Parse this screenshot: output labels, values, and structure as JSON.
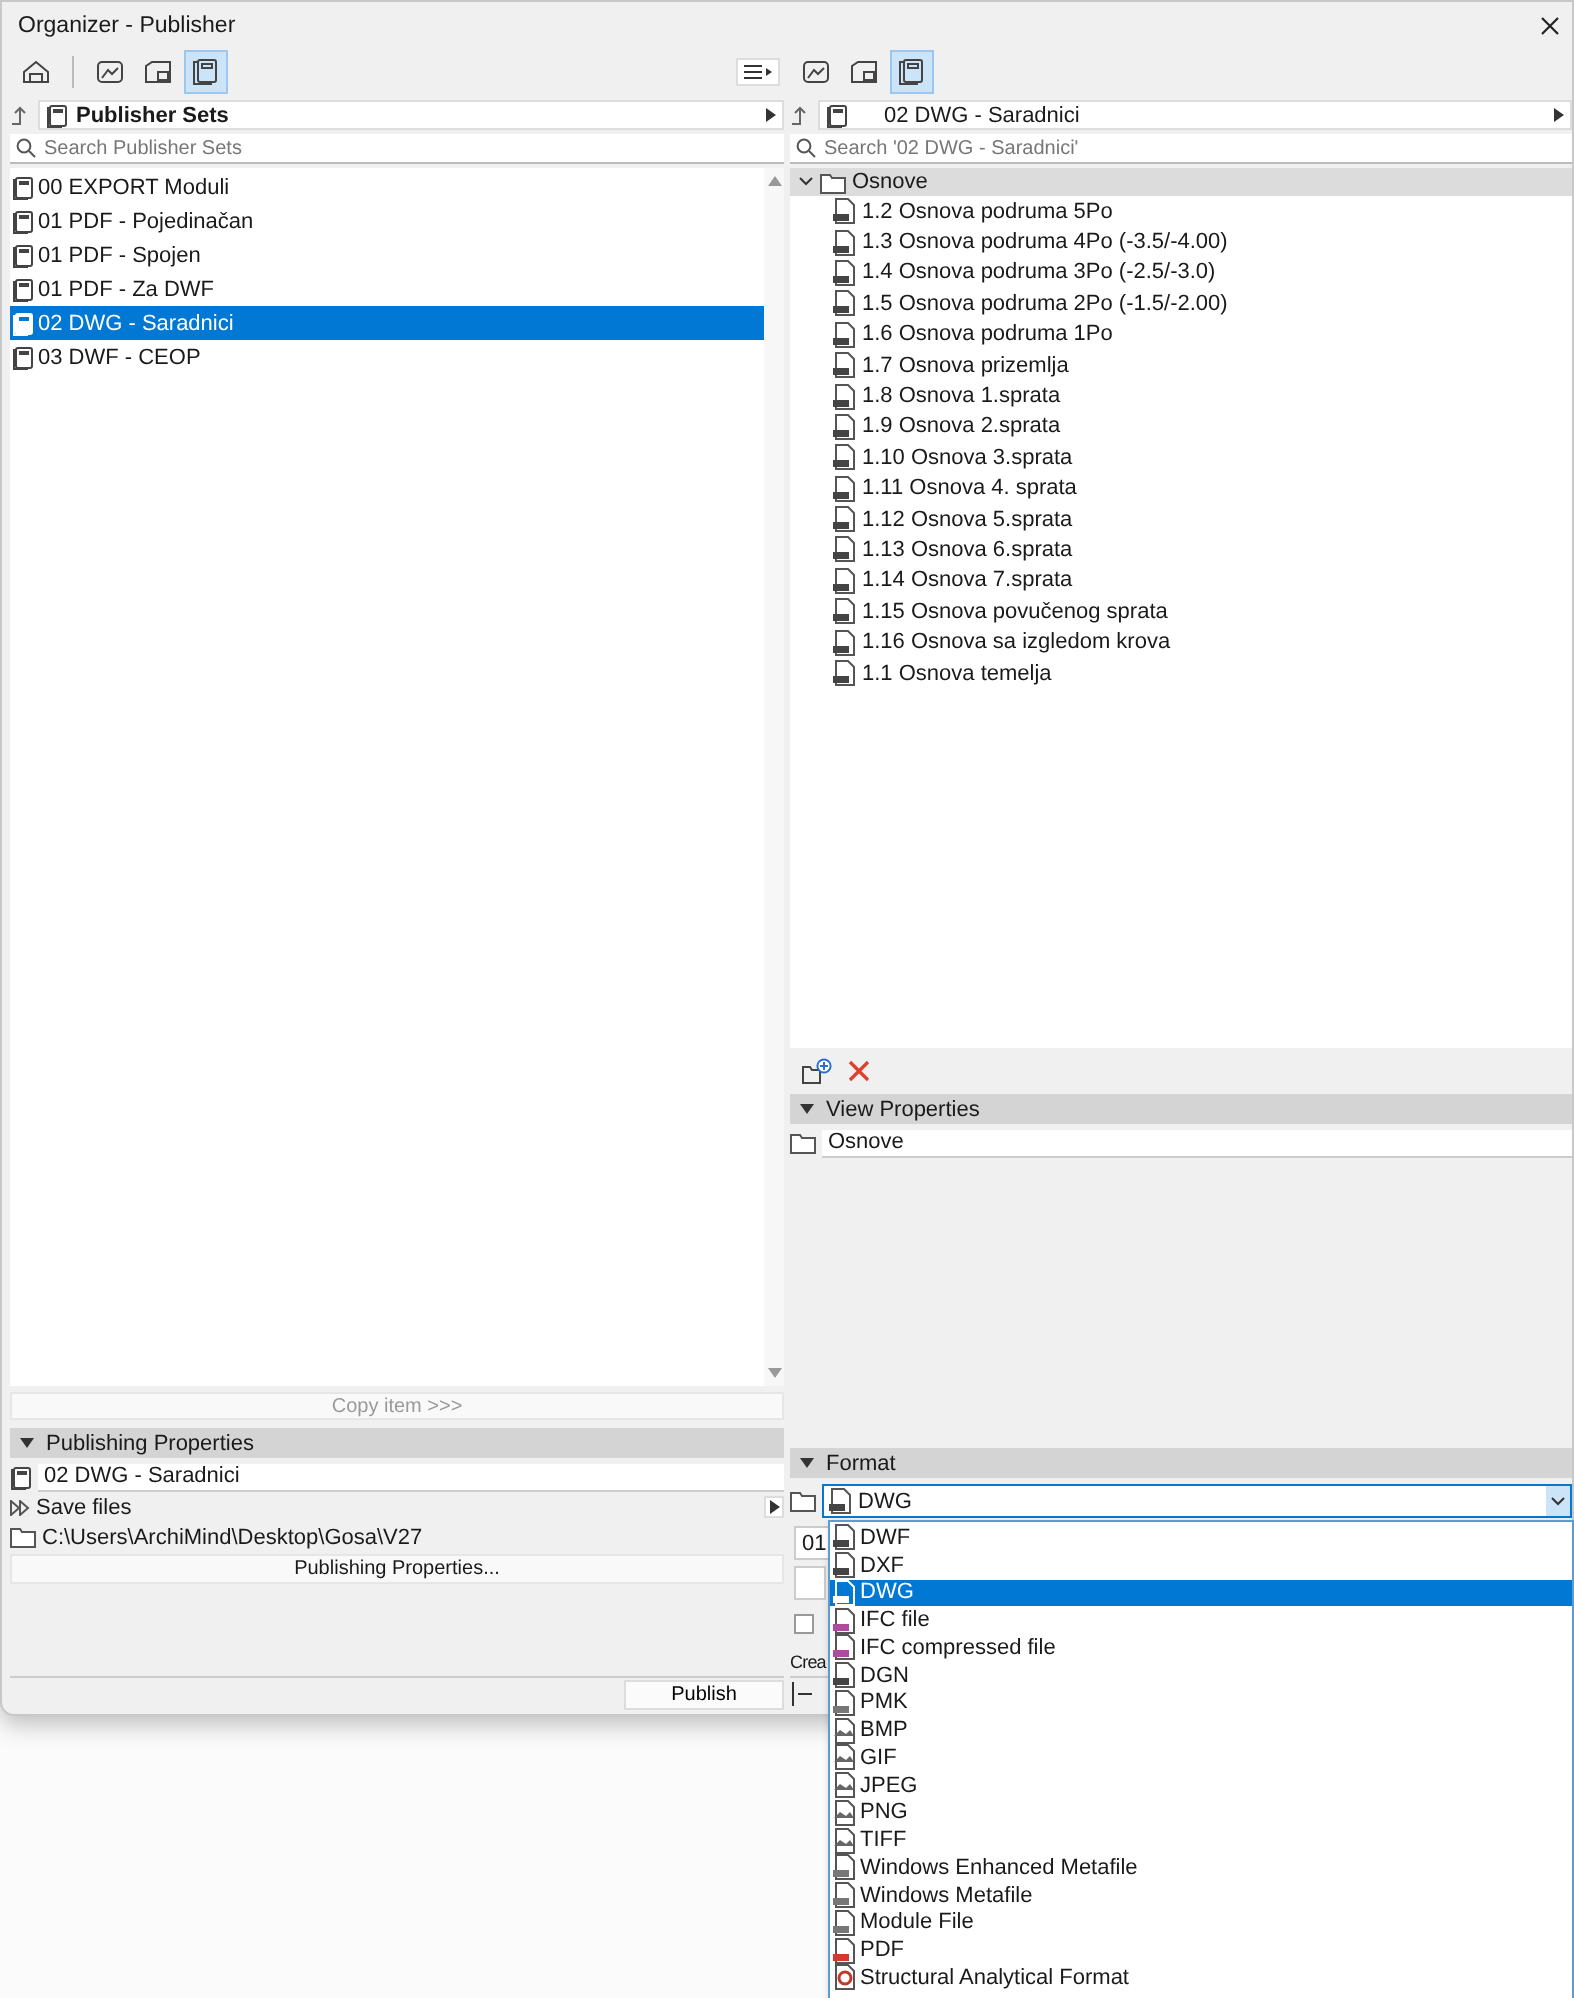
{
  "window": {
    "title": "Organizer - Publisher"
  },
  "left_panel": {
    "toolbar": [
      {
        "kind": "project",
        "selected": false
      },
      {
        "kind": "views",
        "selected": false
      },
      {
        "kind": "layouts",
        "selected": false
      },
      {
        "kind": "sets",
        "selected": true
      }
    ],
    "path": "Publisher Sets",
    "search": {
      "placeholder": "Search Publisher Sets"
    },
    "sets": [
      {
        "label": "00 EXPORT Moduli",
        "selected": false
      },
      {
        "label": "01 PDF - Pojedinačan",
        "selected": false
      },
      {
        "label": "01 PDF - Spojen",
        "selected": false
      },
      {
        "label": "01 PDF - Za DWF",
        "selected": false
      },
      {
        "label": "02 DWG - Saradnici",
        "selected": true
      },
      {
        "label": "03 DWF - CEOP",
        "selected": false
      }
    ],
    "copy_button": {
      "label": "Copy item >>>",
      "disabled": true
    },
    "publishing_properties": {
      "header": "Publishing Properties",
      "expanded": true,
      "name": "02 DWG - Saradnici",
      "mode": "Save files",
      "path": "C:\\Users\\ArchiMind\\Desktop\\Gosa\\V27",
      "button": "Publishing Properties..."
    },
    "publish_button": "Publish"
  },
  "right_panel": {
    "toolbar": [
      {
        "kind": "views",
        "selected": false
      },
      {
        "kind": "layouts",
        "selected": false
      },
      {
        "kind": "sets",
        "selected": true
      }
    ],
    "path": "02 DWG - Saradnici",
    "search": {
      "placeholder": "Search '02 DWG - Saradnici'"
    },
    "tree": {
      "label": "Osnove",
      "expanded": true,
      "children": [
        {
          "label": "1.2 Osnova podruma 5Po"
        },
        {
          "label": "1.3 Osnova podruma 4Po (-3.5/-4.00)"
        },
        {
          "label": "1.4 Osnova podruma 3Po (-2.5/-3.0)"
        },
        {
          "label": "1.5 Osnova podruma 2Po (-1.5/-2.00)"
        },
        {
          "label": "1.6 Osnova podruma 1Po"
        },
        {
          "label": "1.7 Osnova prizemlja"
        },
        {
          "label": "1.8 Osnova 1.sprata"
        },
        {
          "label": "1.9 Osnova 2.sprata"
        },
        {
          "label": "1.10 Osnova 3.sprata"
        },
        {
          "label": "1.11 Osnova 4. sprata"
        },
        {
          "label": "1.12 Osnova 5.sprata"
        },
        {
          "label": "1.13 Osnova 6.sprata"
        },
        {
          "label": "1.14 Osnova 7.sprata"
        },
        {
          "label": "1.15 Osnova povučenog sprata"
        },
        {
          "label": "1.16 Osnova sa izgledom krova"
        },
        {
          "label": "1.1 Osnova temelja"
        }
      ]
    },
    "view_properties": {
      "header": "View Properties",
      "expanded": true,
      "name": "Osnove"
    },
    "format": {
      "header": "Format",
      "expanded": true,
      "value": "DWG",
      "open": true,
      "options": [
        {
          "label": "DWF",
          "kind": "cad",
          "selected": false
        },
        {
          "label": "DXF",
          "kind": "cad",
          "selected": false
        },
        {
          "label": "DWG",
          "kind": "cad",
          "selected": true
        },
        {
          "label": "IFC file",
          "kind": "ifc",
          "selected": false
        },
        {
          "label": "IFC compressed file",
          "kind": "ifc",
          "selected": false
        },
        {
          "label": "DGN",
          "kind": "cad",
          "selected": false
        },
        {
          "label": "PMK",
          "kind": "doc",
          "selected": false
        },
        {
          "label": "BMP",
          "kind": "image",
          "selected": false
        },
        {
          "label": "GIF",
          "kind": "image",
          "selected": false
        },
        {
          "label": "JPEG",
          "kind": "image",
          "selected": false
        },
        {
          "label": "PNG",
          "kind": "image",
          "selected": false
        },
        {
          "label": "TIFF",
          "kind": "image",
          "selected": false
        },
        {
          "label": "Windows Enhanced Metafile",
          "kind": "doc",
          "selected": false
        },
        {
          "label": "Windows Metafile",
          "kind": "doc",
          "selected": false
        },
        {
          "label": "Module File",
          "kind": "doc",
          "selected": false
        },
        {
          "label": "PDF",
          "kind": "pdf",
          "selected": false
        },
        {
          "label": "Structural Analytical Format",
          "kind": "saf",
          "selected": false
        }
      ]
    },
    "hidden_field": "01",
    "hidden_checkbox": {
      "checked": false
    },
    "hidden_label": "Crea"
  }
}
